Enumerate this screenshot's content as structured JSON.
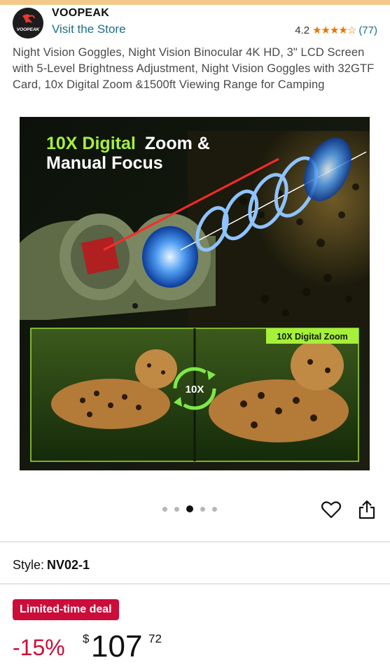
{
  "store": {
    "brand": "VOOPEAK",
    "logo_text": "VOOPEAK",
    "visit_label": "Visit the Store",
    "rating_value": "4.2",
    "rating_stars": "★★★★☆",
    "rating_count": "(77)"
  },
  "product": {
    "title": "Night Vision Goggles, Night Vision Binocular 4K HD, 3\" LCD Screen with 5-Level Brightness Adjustment, Night Vision Goggles with 32GTF Card, 10x Digital Zoom &1500ft Viewing Range for Camping"
  },
  "hero": {
    "headline_accent": "10X Digital",
    "headline_rest": "Zoom &",
    "headline_line2": "Manual Focus",
    "badge": "10X Digital Zoom",
    "circle_label": "10X"
  },
  "carousel": {
    "count": 5,
    "active_index": 2
  },
  "style": {
    "label": "Style:",
    "value": "NV02-1"
  },
  "price": {
    "deal_badge": "Limited-time deal",
    "discount": "-15%",
    "currency": "$",
    "whole": "107",
    "fraction": "72"
  },
  "colors": {
    "accent_link": "#1b6e86",
    "deal_red": "#cc0c39",
    "star_orange": "#e77600",
    "headline_green": "#a6f03a",
    "top_bar": "#f3c98b"
  },
  "icons": [
    "heart-icon",
    "share-icon",
    "star-icon",
    "refresh-arrows-icon"
  ]
}
